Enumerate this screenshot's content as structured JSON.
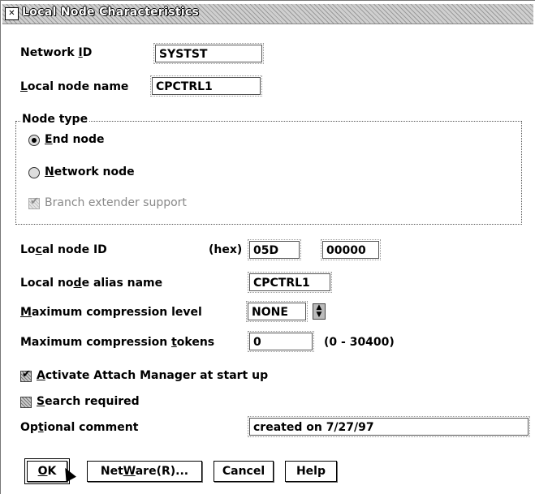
{
  "window": {
    "title": "Local Node Characteristics",
    "system_menu_glyph": "✕"
  },
  "network_id": {
    "label_pre": "Network ",
    "label_key": "I",
    "label_post": "D",
    "value": "SYSTST"
  },
  "local_node_name": {
    "label_key": "L",
    "label_post": "ocal node name",
    "value": "CPCTRL1"
  },
  "node_type": {
    "legend": "Node type",
    "end_node": {
      "label_key": "E",
      "label_post": "nd node",
      "selected": true
    },
    "network_node": {
      "label_key": "N",
      "label_post": "etwork node",
      "selected": false
    },
    "branch_extender": {
      "label": "Branch extender support",
      "checked": true,
      "enabled": false
    }
  },
  "local_node_id": {
    "label_pre": "Lo",
    "label_key": "c",
    "label_post": "al node ID",
    "hex_label": "(hex)",
    "value1": "05D",
    "value2": "00000"
  },
  "local_node_alias": {
    "label_pre": "Local no",
    "label_key": "d",
    "label_post": "e alias name",
    "value": "CPCTRL1"
  },
  "max_compression_level": {
    "label_key": "M",
    "label_post": "aximum compression level",
    "value": "NONE"
  },
  "max_compression_tokens": {
    "label_pre": "Maximum compression ",
    "label_key": "t",
    "label_post": "okens",
    "value": "0",
    "range": "(0 - 30400)"
  },
  "activate_attach": {
    "label_key": "A",
    "label_post": "ctivate Attach Manager at start up",
    "checked": true
  },
  "search_required": {
    "label_key": "S",
    "label_post": "earch required",
    "checked": false
  },
  "optional_comment": {
    "label_pre": "Op",
    "label_key": "t",
    "label_post": "ional comment",
    "value": "created on 7/27/97"
  },
  "buttons": {
    "ok": {
      "label_key": "O",
      "label_post": "K"
    },
    "netware": {
      "label_pre": "Net",
      "label_key": "W",
      "label_post": "are(R)..."
    },
    "cancel": "Cancel",
    "help": "Help"
  },
  "icons": {
    "radio": "radio-button-icon",
    "checkbox": "checkbox-icon",
    "spin": "spin-arrows-icon",
    "cursor": "mouse-pointer-icon"
  }
}
